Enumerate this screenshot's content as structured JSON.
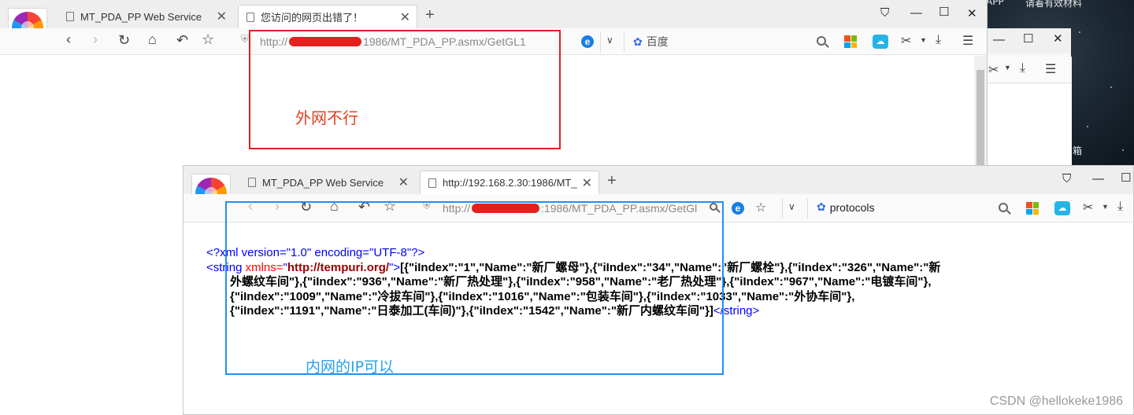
{
  "desktop": {
    "texts": [
      "APP",
      "请着有效材料",
      "箱"
    ]
  },
  "win1": {
    "tabs": [
      {
        "label": "MT_PDA_PP Web Service"
      },
      {
        "label": "您访问的网页出错了！"
      }
    ],
    "address": {
      "prefix": "http://",
      "suffix": "1986/MT_PDA_PP.asmx/GetGL1"
    },
    "search": {
      "label": "百度"
    }
  },
  "win2": {
    "tabs": [
      {
        "label": "MT_PDA_PP Web Service"
      },
      {
        "label": "http://192.168.2.30:1986/MT_"
      }
    ],
    "address": {
      "prefix": "http://",
      "suffix": ":1986/MT_PDA_PP.asmx/GetGl"
    },
    "search": {
      "label": "protocols"
    },
    "xml": {
      "decl": "<?xml version=\"1.0\" encoding=\"UTF-8\"?>",
      "open_tag_start": "<string ",
      "attr_name": "xmlns=",
      "attr_q1": "\"",
      "attr_value": "http://tempuri.org/",
      "attr_q2": "\">",
      "line1": "[{\"iIndex\":\"1\",\"Name\":\"新厂螺母\"},{\"iIndex\":\"34\",\"Name\":\"新厂螺栓\"},{\"iIndex\":\"326\",\"Name\":\"新",
      "line2": "外螺纹车间\"},{\"iIndex\":\"936\",\"Name\":\"新厂热处理\"},{\"iIndex\":\"958\",\"Name\":\"老厂热处理\"},{\"iIndex\":\"967\",\"Name\":\"电镀车间\"},",
      "line3": "{\"iIndex\":\"1009\",\"Name\":\"冷拔车间\"},{\"iIndex\":\"1016\",\"Name\":\"包装车间\"},{\"iIndex\":\"1033\",\"Name\":\"外协车间\"},",
      "line4": "{\"iIndex\":\"1191\",\"Name\":\"日泰加工(车间)\"},{\"iIndex\":\"1542\",\"Name\":\"新厂内螺纹车间\"}]",
      "close_tag": "</string>"
    }
  },
  "annotations": {
    "red": "外网不行",
    "blue": "内网的IP可以"
  },
  "watermark": "CSDN @hellokeke1986",
  "colors": {
    "red_annotation": "#e02020",
    "blue_annotation": "#1e90ff"
  }
}
